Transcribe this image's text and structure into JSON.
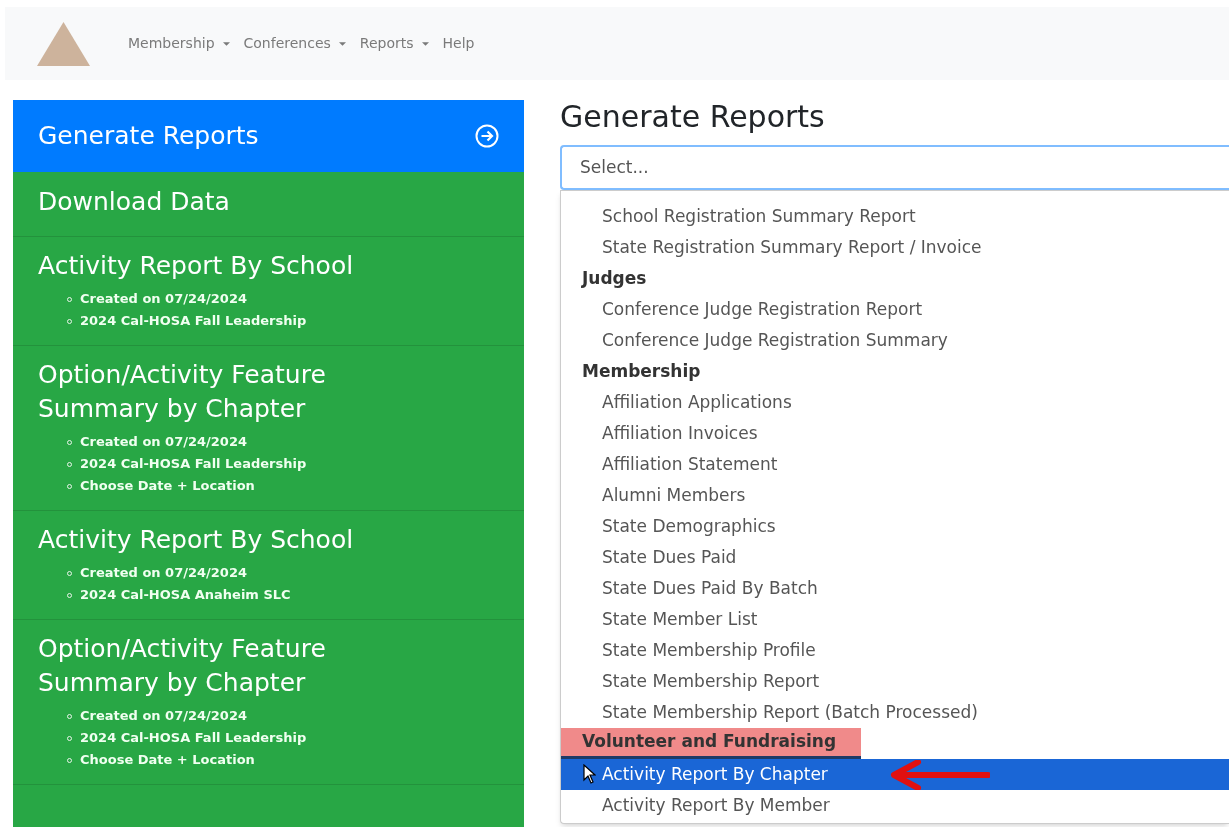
{
  "navbar": {
    "items": [
      {
        "label": "Membership",
        "dropdown": true
      },
      {
        "label": "Conferences",
        "dropdown": true
      },
      {
        "label": "Reports",
        "dropdown": true
      },
      {
        "label": "Help",
        "dropdown": false
      }
    ]
  },
  "sidebar": {
    "items": [
      {
        "title": "Generate Reports",
        "selected": true
      },
      {
        "title": "Download Data",
        "selected": false
      },
      {
        "title": "Activity Report By School",
        "selected": false,
        "details": [
          "Created on 07/24/2024",
          "2024 Cal-HOSA Fall Leadership"
        ]
      },
      {
        "title": "Option/Activity Feature Summary by Chapter",
        "selected": false,
        "details": [
          "Created on 07/24/2024",
          "2024 Cal-HOSA Fall Leadership",
          "Choose Date + Location"
        ]
      },
      {
        "title": "Activity Report By School",
        "selected": false,
        "details": [
          "Created on 07/24/2024",
          "2024 Cal-HOSA Anaheim SLC"
        ]
      },
      {
        "title": "Option/Activity Feature Summary by Chapter",
        "selected": false,
        "details": [
          "Created on 07/24/2024",
          "2024 Cal-HOSA Fall Leadership",
          "Choose Date + Location"
        ]
      }
    ]
  },
  "main": {
    "title": "Generate Reports",
    "select": {
      "placeholder": "Select..."
    },
    "dropdown": {
      "items": [
        {
          "kind": "option",
          "label": "School Registration Summary Report",
          "selected": false,
          "highlighted": false
        },
        {
          "kind": "option",
          "label": "State Registration Summary Report / Invoice",
          "selected": false,
          "highlighted": false
        },
        {
          "kind": "group",
          "label": "Judges",
          "selected": false,
          "highlighted": false
        },
        {
          "kind": "option",
          "label": "Conference Judge Registration Report",
          "selected": false,
          "highlighted": false
        },
        {
          "kind": "option",
          "label": "Conference Judge Registration Summary",
          "selected": false,
          "highlighted": false
        },
        {
          "kind": "group",
          "label": "Membership",
          "selected": false,
          "highlighted": false
        },
        {
          "kind": "option",
          "label": "Affiliation Applications",
          "selected": false,
          "highlighted": false
        },
        {
          "kind": "option",
          "label": "Affiliation Invoices",
          "selected": false,
          "highlighted": false
        },
        {
          "kind": "option",
          "label": "Affiliation Statement",
          "selected": false,
          "highlighted": false
        },
        {
          "kind": "option",
          "label": "Alumni Members",
          "selected": false,
          "highlighted": false
        },
        {
          "kind": "option",
          "label": "State Demographics",
          "selected": false,
          "highlighted": false
        },
        {
          "kind": "option",
          "label": "State Dues Paid",
          "selected": false,
          "highlighted": false
        },
        {
          "kind": "option",
          "label": "State Dues Paid By Batch",
          "selected": false,
          "highlighted": false
        },
        {
          "kind": "option",
          "label": "State Member List",
          "selected": false,
          "highlighted": false
        },
        {
          "kind": "option",
          "label": "State Membership Profile",
          "selected": false,
          "highlighted": false
        },
        {
          "kind": "option",
          "label": "State Membership Report",
          "selected": false,
          "highlighted": false
        },
        {
          "kind": "option",
          "label": "State Membership Report (Batch Processed)",
          "selected": false,
          "highlighted": false
        },
        {
          "kind": "group",
          "label": "Volunteer and Fundraising",
          "selected": false,
          "highlighted": true
        },
        {
          "kind": "option",
          "label": "Activity Report By Chapter",
          "selected": true,
          "highlighted": false
        },
        {
          "kind": "option",
          "label": "Activity Report By Member",
          "selected": false,
          "highlighted": false
        }
      ]
    }
  }
}
